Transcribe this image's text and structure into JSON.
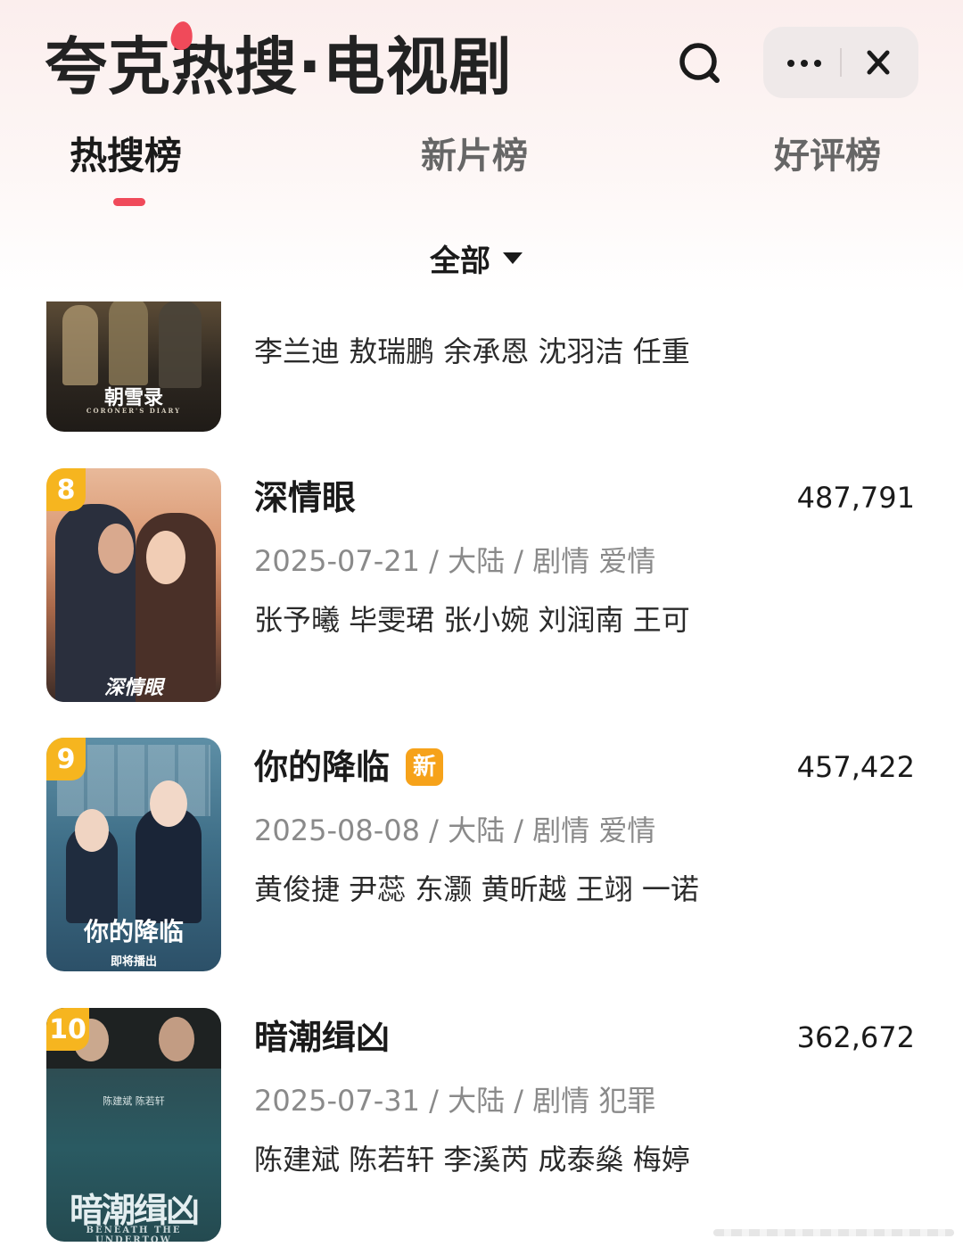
{
  "app": {
    "title": "夸克热搜·电视剧"
  },
  "tabs": [
    {
      "label": "热搜榜",
      "active": true
    },
    {
      "label": "新片榜",
      "active": false
    },
    {
      "label": "好评榜",
      "active": false
    }
  ],
  "filter": {
    "label": "全部"
  },
  "partial_item": {
    "cast": "李兰迪 敖瑞鹏 余承恩 沈羽洁 任重",
    "poster_text": "朝雪录",
    "poster_subtext": "CORONER'S DIARY"
  },
  "items": [
    {
      "rank": "8",
      "name": "深情眼",
      "meta": "2025-07-21 / 大陆 / 剧情 爱情",
      "cast": "张予曦 毕雯珺 张小婉 刘润南 王可",
      "score": "487,791",
      "is_new": false,
      "poster_text": "深情眼"
    },
    {
      "rank": "9",
      "name": "你的降临",
      "meta": "2025-08-08 / 大陆 / 剧情 爱情",
      "cast": "黄俊捷 尹蕊 东灏 黄昕越 王翊 一诺",
      "score": "457,422",
      "is_new": true,
      "new_label": "新",
      "poster_text": "你的降临",
      "poster_subtext": "即将播出"
    },
    {
      "rank": "10",
      "name": "暗潮缉凶",
      "meta": "2025-07-31 / 大陆 / 剧情 犯罪",
      "cast": "陈建斌 陈若轩 李溪芮 成泰燊 梅婷",
      "score": "362,672",
      "is_new": false,
      "poster_text": "暗潮缉凶",
      "poster_names": "陈建斌 陈若轩",
      "poster_subtext": "BENEATH THE UNDERTOW"
    }
  ],
  "colors": {
    "accent": "#f04a5a",
    "rank_badge": "#f6b51f",
    "new_badge": "#f6a21a"
  }
}
